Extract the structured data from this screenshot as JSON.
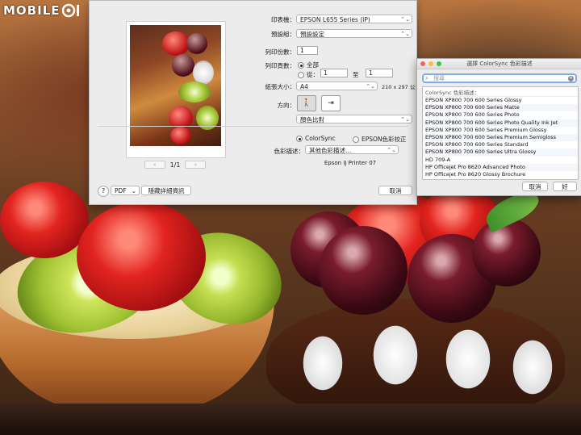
{
  "logo": {
    "text": "MOBILE",
    "icon": "mobile01-logo-icon"
  },
  "print_dialog": {
    "preview": {
      "page_indicator": "1/1",
      "first_icon": "first-page-icon",
      "prev_icon": "prev-page-icon",
      "next_icon": "next-page-icon",
      "last_icon": "last-page-icon"
    },
    "printer": {
      "label": "印表機：",
      "value": "EPSON L655 Series (IP)"
    },
    "preset": {
      "label": "預設組：",
      "value": "預設設定"
    },
    "copies": {
      "label": "列印份數：",
      "value": "1"
    },
    "pages": {
      "label": "列印頁數：",
      "all_label": "全部",
      "from_label": "從：",
      "from_value": "1",
      "to_label": "至",
      "to_value": "1",
      "selected": "all"
    },
    "paper": {
      "label": "紙張大小：",
      "value": "A4",
      "dimensions": "210 x 297 公釐"
    },
    "orientation": {
      "label": "方向：",
      "portrait_icon": "portrait-orientation-icon",
      "landscape_icon": "landscape-orientation-icon",
      "selected": "portrait"
    },
    "section": {
      "value": "顏色比對"
    },
    "color_match": {
      "colorsync_label": "ColorSync",
      "epson_label": "EPSON色彩校正",
      "selected": "colorsync"
    },
    "profile": {
      "label": "色彩描述：",
      "value": "其他色彩描述…"
    },
    "printer_model_note": "Epson IJ Printer 07",
    "help_label": "?",
    "pdf_label": "PDF",
    "hide_details_label": "隱藏詳細資訊",
    "cancel_label": "取消"
  },
  "colorsync_sheet": {
    "title": "選擇 ColorSync 色彩描述",
    "search_placeholder": "搜尋",
    "list_header": "ColorSync 色彩描述：",
    "items": [
      "EPSON XP800 700 600 Series Glossy",
      "EPSON XP800 700 600 Series Matte",
      "EPSON XP800 700 600 Series Photo",
      "EPSON XP800 700 600 Series Photo Quality Ink Jet",
      "EPSON XP800 700 600 Series Premium Glossy",
      "EPSON XP800 700 600 Series Premium Semigloss",
      "EPSON XP800 700 600 Series Standard",
      "EPSON XP800 700 600 Series Ultra Glossy",
      "HD 709-A",
      "HP Officejet Pro 8620 Advanced Photo",
      "HP Officejet Pro 8620 Glossy Brochure"
    ],
    "cancel_label": "取消",
    "ok_label": "好"
  },
  "colors": {
    "accent": "#3478f6",
    "dialog_bg": "#ececec",
    "close": "#fc605c",
    "minimize": "#fdbc40",
    "zoom": "#34c84a"
  }
}
